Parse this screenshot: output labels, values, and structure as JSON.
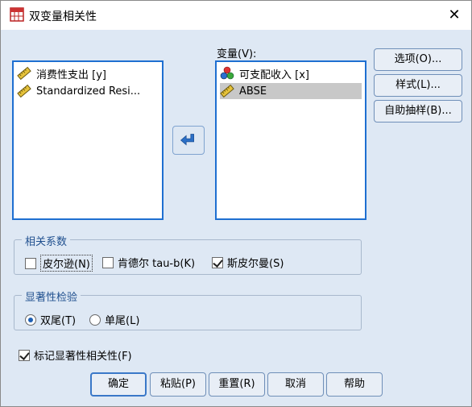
{
  "window": {
    "title": "双变量相关性",
    "close": "✕"
  },
  "source_list": {
    "items": [
      {
        "label": "消费性支出 [y]",
        "icon": "scale-ruler-icon"
      },
      {
        "label": "Standardized Resi...",
        "icon": "scale-ruler-icon"
      }
    ]
  },
  "variables": {
    "label": "变量(V):",
    "items": [
      {
        "label": "可支配收入 [x]",
        "icon": "nominal-balls-icon",
        "selected": false
      },
      {
        "label": "ABSE",
        "icon": "scale-ruler-icon",
        "selected": true
      }
    ]
  },
  "move_button": {
    "icon": "arrow-left-icon"
  },
  "side_buttons": {
    "options": "选项(O)...",
    "style": "样式(L)...",
    "bootstrap": "自助抽样(B)..."
  },
  "correlation": {
    "legend": "相关系数",
    "pearson": {
      "label": "皮尔逊(N)",
      "checked": false
    },
    "kendall": {
      "label": "肯德尔 tau-b(K)",
      "checked": false
    },
    "spearman": {
      "label": "斯皮尔曼(S)",
      "checked": true
    }
  },
  "significance": {
    "legend": "显著性检验",
    "two_tailed": {
      "label": "双尾(T)",
      "checked": true
    },
    "one_tailed": {
      "label": "单尾(L)",
      "checked": false
    }
  },
  "flag": {
    "label": "标记显著性相关性(F)",
    "checked": true
  },
  "bottom_buttons": {
    "ok": "确定",
    "paste": "粘贴(P)",
    "reset": "重置(R)",
    "cancel": "取消",
    "help": "帮助"
  },
  "colors": {
    "accent": "#1e6fd1",
    "dialog_bg": "#dee8f4",
    "legend_text": "#1f4f8e"
  }
}
